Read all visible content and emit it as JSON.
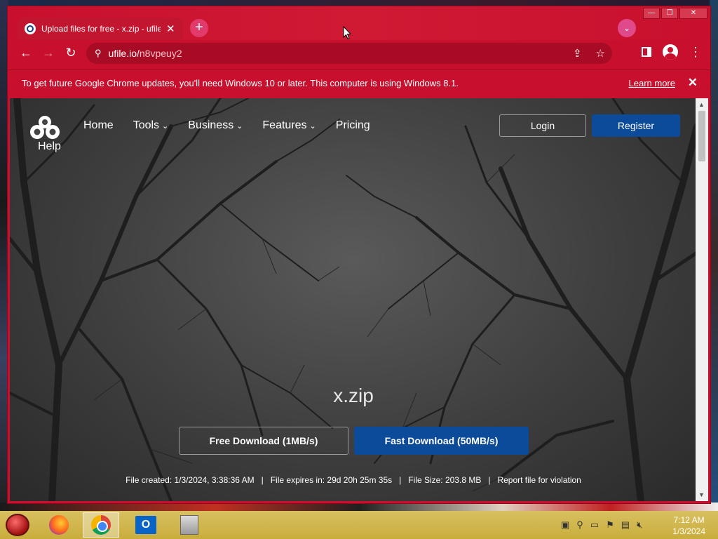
{
  "browser": {
    "tab_title": "Upload files for free - x.zip - ufile.io",
    "tab_close": "✕",
    "new_tab": "+",
    "url_host": "ufile.io/",
    "url_path": "n8vpeuy2",
    "window_controls": [
      "—",
      "❐",
      "✕"
    ]
  },
  "infobar": {
    "message": "To get future Google Chrome updates, you'll need Windows 10 or later. This computer is using Windows 8.1.",
    "learn_more": "Learn more",
    "close": "✕"
  },
  "site": {
    "help_label": "Help",
    "nav": [
      {
        "label": "Home",
        "caret": ""
      },
      {
        "label": "Tools",
        "caret": "⌄"
      },
      {
        "label": "Business",
        "caret": "⌄"
      },
      {
        "label": "Features",
        "caret": "⌄"
      },
      {
        "label": "Pricing",
        "caret": ""
      }
    ],
    "login": "Login",
    "register": "Register",
    "file_name": "x.zip",
    "free_download": "Free Download (1MB/s)",
    "fast_download": "Fast Download (50MB/s)",
    "file_created": "File created: 1/3/2024, 3:38:36 AM",
    "file_expires": "File expires in: 29d 20h 25m 35s",
    "file_size": "File Size: 203.8 MB",
    "report": "Report file for violation",
    "separator": "|"
  },
  "taskbar": {
    "apps": [
      "firefox-icon",
      "chrome-icon",
      "outlook-icon",
      "file-manager-icon"
    ],
    "outlook_letter": "O",
    "time": "7:12 AM",
    "date": "1/3/2024"
  },
  "colors": {
    "chrome_frame": "#c8102e",
    "primary_button": "#0c4a9a",
    "taskbar": "#c9ad3c"
  }
}
